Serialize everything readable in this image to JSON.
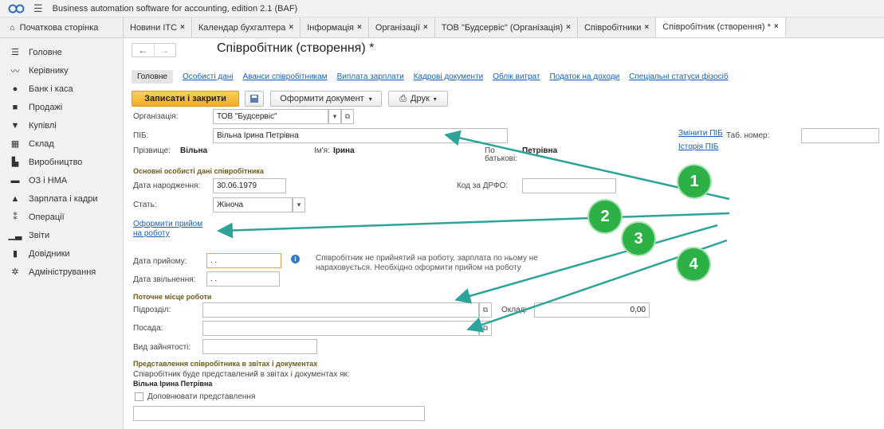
{
  "app": {
    "title": "Business automation software for accounting, edition 2.1  (BAF)"
  },
  "tabs": [
    {
      "label": "Початкова сторінка",
      "closable": false,
      "active": false
    },
    {
      "label": "Новини ІТС",
      "closable": true,
      "active": false
    },
    {
      "label": "Календар бухгалтера",
      "closable": true,
      "active": false
    },
    {
      "label": "Інформація",
      "closable": true,
      "active": false
    },
    {
      "label": "Організації",
      "closable": true,
      "active": false
    },
    {
      "label": "ТОВ \"Будсервіс\" (Організація)",
      "closable": true,
      "active": false
    },
    {
      "label": "Співробітники",
      "closable": true,
      "active": false
    },
    {
      "label": "Співробітник (створення) *",
      "closable": true,
      "active": true
    }
  ],
  "sidebar": {
    "items": [
      {
        "label": "Головне",
        "icon": "menu-lines-icon"
      },
      {
        "label": "Керівнику",
        "icon": "trend-icon"
      },
      {
        "label": "Банк і каса",
        "icon": "coin-icon"
      },
      {
        "label": "Продажі",
        "icon": "bag-icon"
      },
      {
        "label": "Купівлі",
        "icon": "cart-icon"
      },
      {
        "label": "Склад",
        "icon": "warehouse-icon"
      },
      {
        "label": "Виробництво",
        "icon": "factory-icon"
      },
      {
        "label": "ОЗ і НМА",
        "icon": "truck-icon"
      },
      {
        "label": "Зарплата і кадри",
        "icon": "person-icon"
      },
      {
        "label": "Операції",
        "icon": "operations-icon"
      },
      {
        "label": "Звіти",
        "icon": "chart-icon"
      },
      {
        "label": "Довідники",
        "icon": "book-icon"
      },
      {
        "label": "Адміністрування",
        "icon": "gear-icon"
      }
    ]
  },
  "form": {
    "title": "Співробітник (створення) *",
    "subtabs": [
      "Головне",
      "Особисті дані",
      "Аванси співробітникам",
      "Виплата зарплати",
      "Кадрові документи",
      "Облік витрат",
      "Податок на доходи",
      "Спеціальні статуси фізосіб"
    ],
    "toolbar": {
      "save_close": "Записати і закрити",
      "make_doc": "Оформити документ",
      "print": "Друк"
    },
    "org_label": "Організація:",
    "org_value": "ТОВ \"Будсервіс\"",
    "pib_label": "ПІБ:",
    "pib_value": "Вільна Ірина Петрівна",
    "change_pib": "Змінити ПІБ",
    "tab_num_label": "Таб. номер:",
    "tab_num_value": "",
    "history_pib": "Історія ПІБ",
    "surname_label": "Прізвище:",
    "surname_value": "Вільна",
    "name_label": "Ім'я:",
    "name_value": "Ірина",
    "patronymic_label_1": "По",
    "patronymic_label_2": "батькові:",
    "patronymic_value": "Петрівна",
    "section_personal": "Основні особисті дані співробітника",
    "birth_label": "Дата народження:",
    "birth_value": "30.06.1979",
    "drfo_label": "Код за ДРФО:",
    "drfo_value": "",
    "sex_label": "Стать:",
    "sex_value": "Жіноча",
    "hire_link_1": "Оформити прийом",
    "hire_link_2": "на роботу",
    "hire_date_label": "Дата прийому:",
    "hire_date_value": " .  .",
    "hire_info_1": "Співробітник не прийнятий на роботу, зарплата по ньому не",
    "hire_info_2": "нараховується. Необхідно оформити прийом на роботу",
    "fire_date_label": "Дата звільнення:",
    "fire_date_value": " .  .",
    "section_workplace": "Поточне місце роботи",
    "dept_label": "Підрозділ:",
    "dept_value": "",
    "salary_label": "Оклад:",
    "salary_value": "0,00",
    "position_label": "Посада:",
    "position_value": "",
    "employment_label": "Вид зайнятості:",
    "employment_value": "",
    "section_repr": "Представлення співробітника в звітах і документах",
    "repr_info": "Співробітник буде представлений в звітах і документах як:",
    "repr_name": "Вільна Ірина Петрівна",
    "repr_checkbox": "Доповнювати представлення",
    "repr_input_value": ""
  },
  "annotations": {
    "markers": [
      "1",
      "2",
      "3",
      "4"
    ],
    "color": "#2db045"
  }
}
